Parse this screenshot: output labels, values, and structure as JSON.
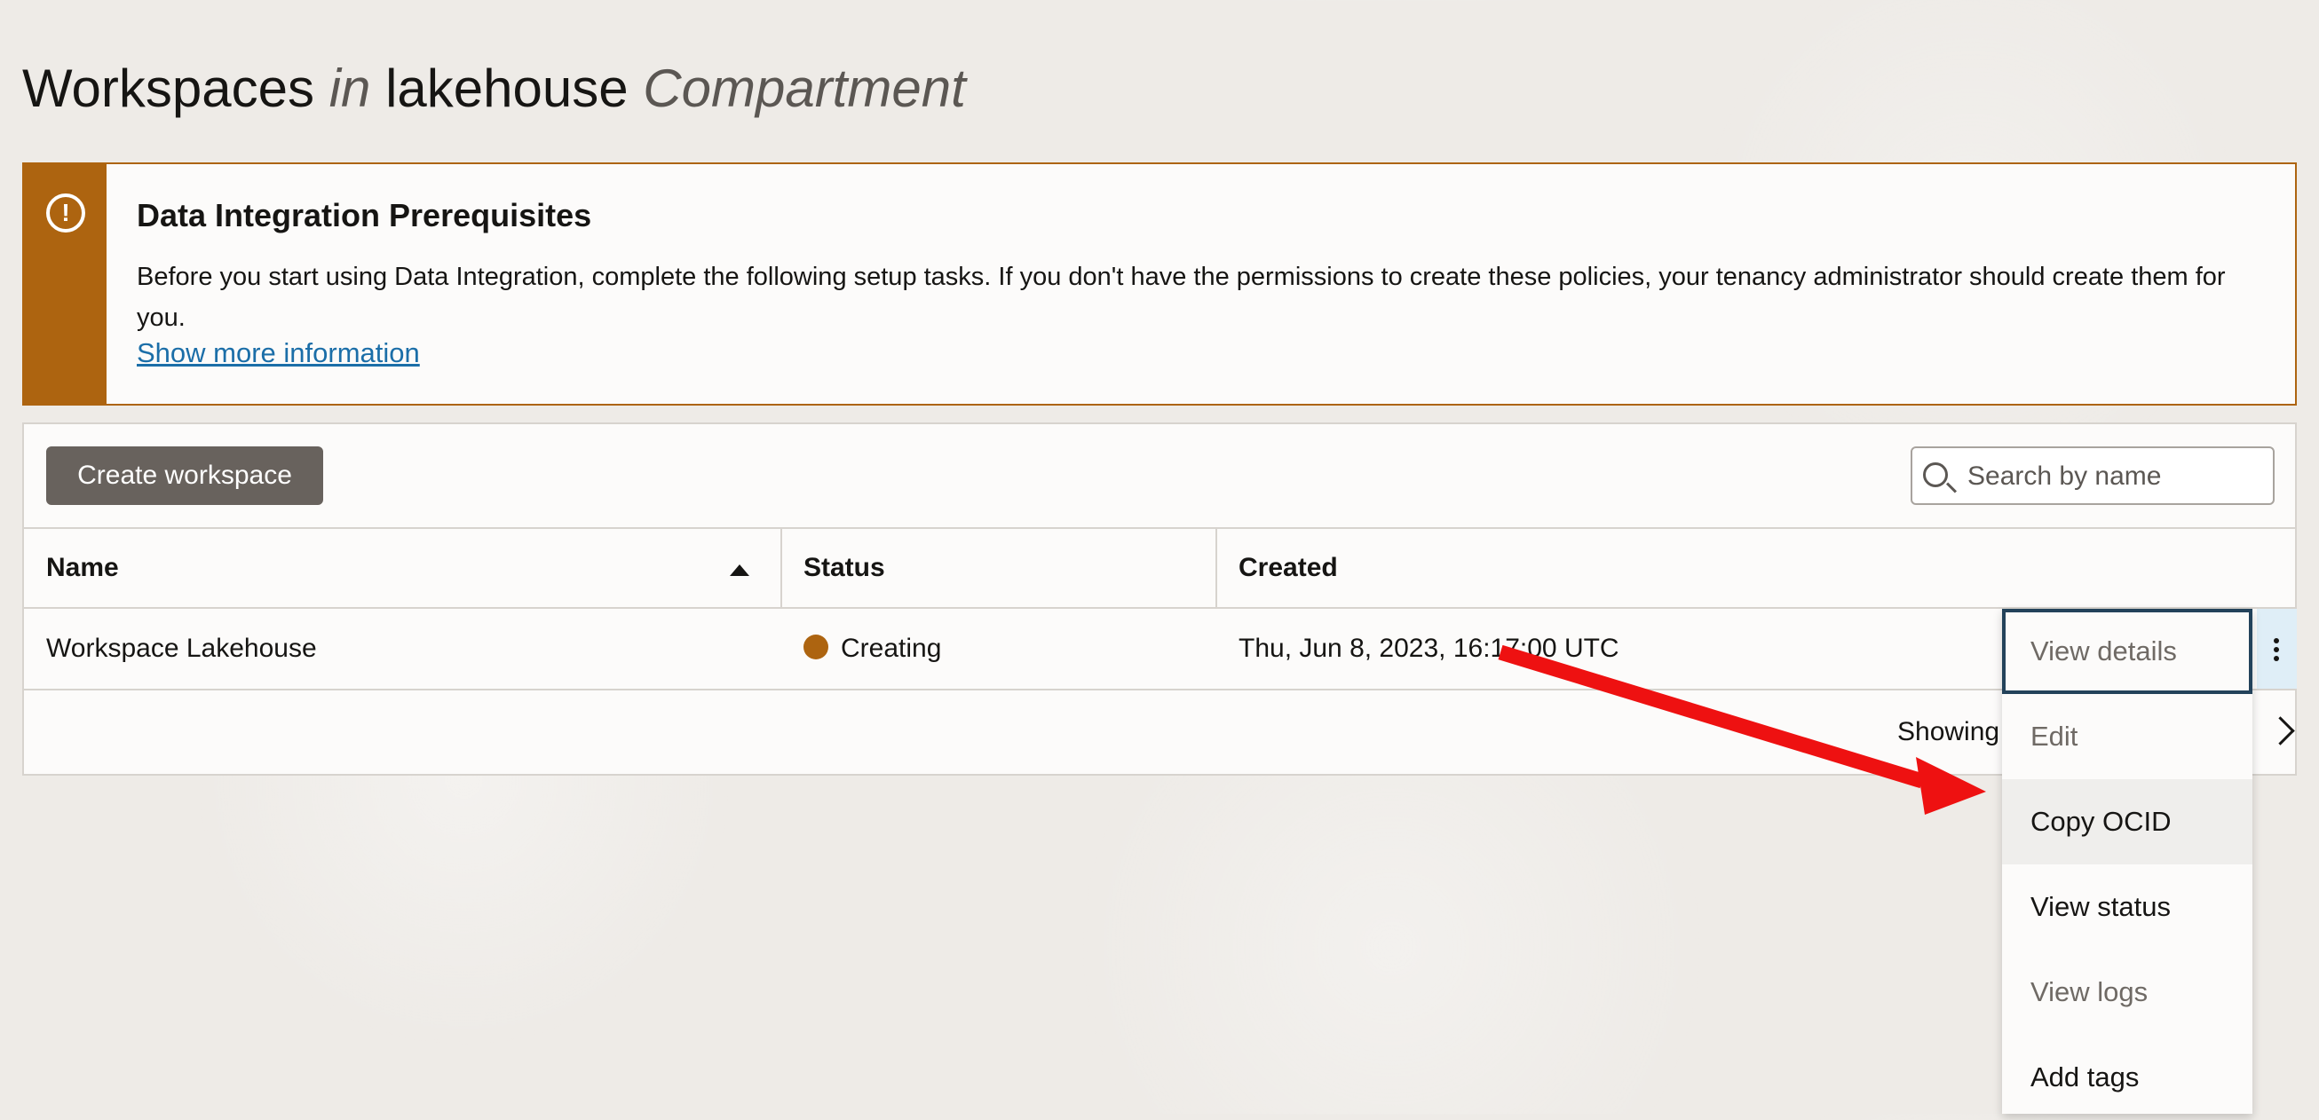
{
  "page": {
    "title_prefix": "Workspaces",
    "title_in": "in",
    "compartment": "lakehouse",
    "title_suffix": "Compartment"
  },
  "banner": {
    "icon": "warning-circle-icon",
    "title": "Data Integration Prerequisites",
    "body": "Before you start using Data Integration, complete the following setup tasks. If you don't have the permissions to create these policies, your tenancy administrator should create them for you.",
    "link": "Show more information",
    "accent_color": "#ad6410"
  },
  "toolbar": {
    "create_label": "Create workspace",
    "search_placeholder": "Search by name"
  },
  "table": {
    "columns": [
      "Name",
      "Status",
      "Created"
    ],
    "sort": "Name ascending",
    "rows": [
      {
        "name": "Workspace Lakehouse",
        "status": "Creating",
        "status_color": "#ad6410",
        "created": "Thu, Jun 8, 2023, 16:17:00 UTC"
      }
    ],
    "pager_text": "Showing"
  },
  "menu": {
    "items": [
      "View details",
      "Edit",
      "Copy OCID",
      "View status",
      "View logs",
      "Add tags"
    ]
  },
  "annotation": {
    "arrow_color": "#ee1111"
  }
}
